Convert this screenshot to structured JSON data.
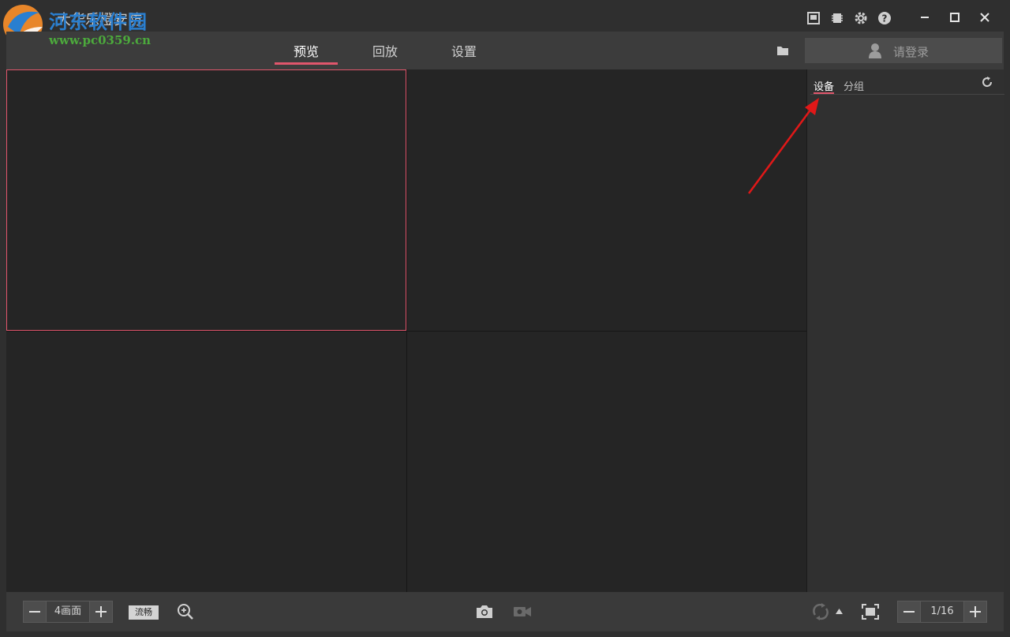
{
  "app": {
    "title": "大华乐橙安防",
    "watermark_brand": "河东软件园",
    "watermark_url": "www.pc0359.cn"
  },
  "titlebar": {
    "icons": [
      "layout-icon",
      "chip-icon",
      "gear-icon",
      "help-icon"
    ],
    "window_controls": [
      "minimize-icon",
      "maximize-icon",
      "close-icon"
    ]
  },
  "nav": {
    "tabs": [
      {
        "label": "预览",
        "active": true
      },
      {
        "label": "回放",
        "active": false
      },
      {
        "label": "设置",
        "active": false
      }
    ],
    "accent_color": "#e0566c",
    "login_label": "请登录"
  },
  "sidebar": {
    "tabs": [
      {
        "label": "设备",
        "active": true
      },
      {
        "label": "分组",
        "active": false
      }
    ]
  },
  "preview_grid": {
    "layout": "2x2",
    "selected_cell": 1
  },
  "bottombar": {
    "split_label": "4画面",
    "stream_label": "流畅",
    "page_label": "1/16"
  }
}
